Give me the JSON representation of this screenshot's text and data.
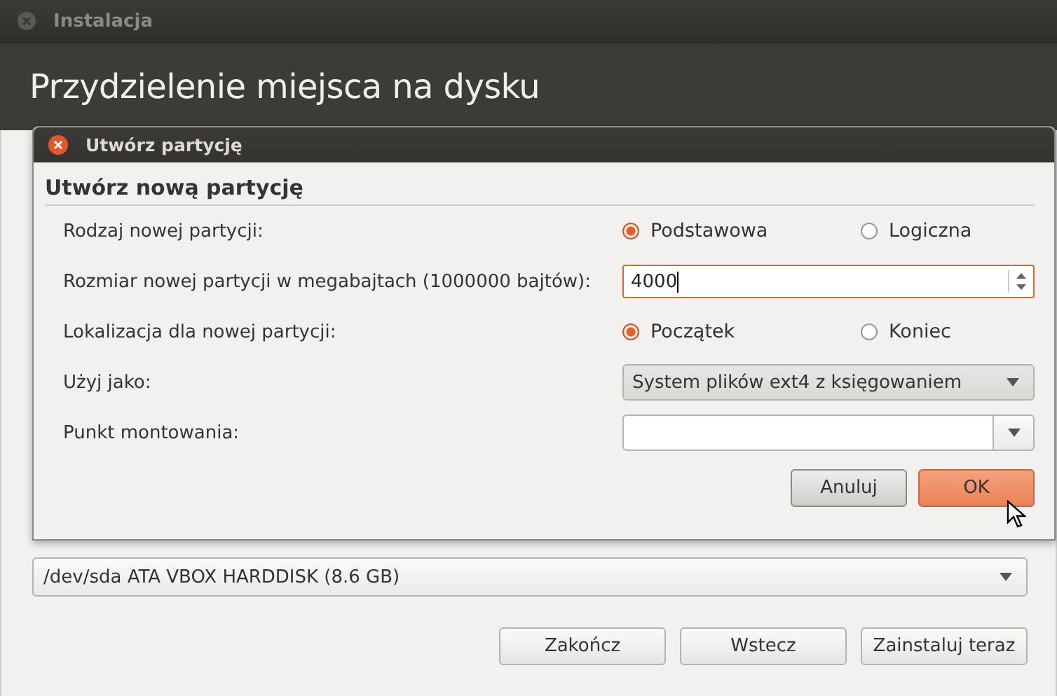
{
  "window": {
    "title": "Instalacja",
    "heading": "Przydzielenie miejsca na dysku"
  },
  "dialog": {
    "title": "Utwórz partycję",
    "heading": "Utwórz nową partycję",
    "rows": [
      {
        "kind": "radio",
        "label": "Rodzaj nowej partycji:",
        "options": [
          {
            "label": "Podstawowa",
            "selected": true
          },
          {
            "label": "Logiczna",
            "selected": false
          }
        ]
      },
      {
        "kind": "spin",
        "label": "Rozmiar nowej partycji w megabajtach (1000000 bajtów):",
        "value": "4000"
      },
      {
        "kind": "radio",
        "label": "Lokalizacja dla nowej partycji:",
        "options": [
          {
            "label": "Początek",
            "selected": true
          },
          {
            "label": "Koniec",
            "selected": false
          }
        ]
      },
      {
        "kind": "combo",
        "label": "Użyj jako:",
        "value": "System plików ext4 z księgowaniem"
      },
      {
        "kind": "entry-combo",
        "label": "Punkt montowania:"
      }
    ],
    "buttons": [
      {
        "label": "Anuluj",
        "default": false
      },
      {
        "label": "OK",
        "default": true
      }
    ]
  },
  "device": {
    "value": "/dev/sda ATA VBOX HARDDISK (8.6 GB)"
  },
  "buttons": [
    "Zakończ",
    "Wstecz",
    "Zainstaluj teraz"
  ]
}
